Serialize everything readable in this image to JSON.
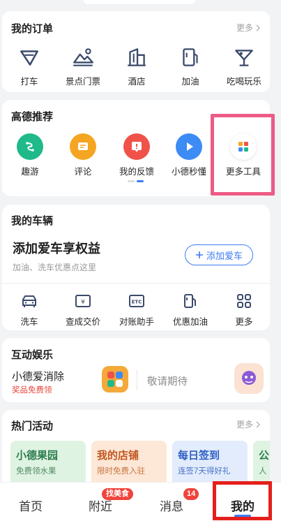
{
  "orders": {
    "title": "我的订单",
    "more": "更多",
    "items": [
      {
        "label": "打车",
        "icon": "taxi-flag-icon"
      },
      {
        "label": "景点门票",
        "icon": "scenic-mountain-icon"
      },
      {
        "label": "酒店",
        "icon": "hotel-building-icon"
      },
      {
        "label": "加油",
        "icon": "fuel-pump-icon"
      },
      {
        "label": "吃喝玩乐",
        "icon": "cocktail-icon"
      }
    ]
  },
  "recommend": {
    "title": "高德推荐",
    "items": [
      {
        "label": "趣游",
        "icon": "route-icon",
        "color": "#1fb98a"
      },
      {
        "label": "评论",
        "icon": "comment-icon",
        "color": "#f5a522"
      },
      {
        "label": "我的反馈",
        "icon": "feedback-icon",
        "color": "#f0524a"
      },
      {
        "label": "小德秒懂",
        "icon": "play-icon",
        "color": "#3d8bf5"
      },
      {
        "label": "更多工具",
        "icon": "more-tools-icon",
        "color": "#ffffff"
      }
    ]
  },
  "vehicle": {
    "title": "我的车辆",
    "headline": "添加爱车享权益",
    "subtitle": "加油、洗车优惠点这里",
    "add_button": "添加爱车",
    "tools": [
      {
        "label": "洗车",
        "icon": "car-wash-icon"
      },
      {
        "label": "查成交价",
        "icon": "price-tag-icon"
      },
      {
        "label": "对账助手",
        "icon": "etc-icon"
      },
      {
        "label": "优惠加油",
        "icon": "fuel-discount-icon"
      },
      {
        "label": "更多",
        "icon": "grid-more-icon"
      }
    ]
  },
  "entertainment": {
    "title": "互动娱乐",
    "game_name": "小德爱消除",
    "game_tag": "奖品免费领",
    "placeholder": "敬请期待"
  },
  "activities": {
    "title": "热门活动",
    "more": "更多",
    "cards": [
      {
        "title": "小德果园",
        "subtitle": "免费领水果"
      },
      {
        "title": "我的店铺",
        "subtitle": "限时免费入驻"
      },
      {
        "title": "每日签到",
        "subtitle": "连签7天得好礼"
      },
      {
        "title": "公",
        "subtitle": "人"
      }
    ]
  },
  "tabbar": {
    "tabs": [
      "首页",
      "附近",
      "消息",
      "我的"
    ],
    "nearby_badge": "找美食",
    "message_badge": "14",
    "active": "我的"
  },
  "colors": {
    "accent": "#3d7cf5",
    "highlight_pink": "#ec5b86",
    "highlight_red": "#e5201c"
  }
}
